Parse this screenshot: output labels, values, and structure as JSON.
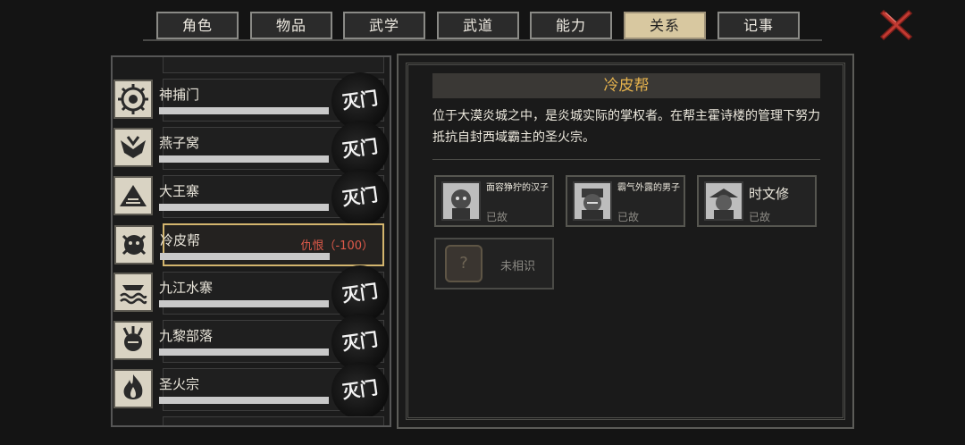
{
  "tabs": [
    {
      "label": "角色",
      "active": false
    },
    {
      "label": "物品",
      "active": false
    },
    {
      "label": "武学",
      "active": false
    },
    {
      "label": "武道",
      "active": false
    },
    {
      "label": "能力",
      "active": false
    },
    {
      "label": "关系",
      "active": true
    },
    {
      "label": "记事",
      "active": false
    }
  ],
  "close_icon": "close-x-icon",
  "factions": [
    {
      "name": "神捕门",
      "status": "灭门",
      "icon": "sun-emblem-icon"
    },
    {
      "name": "燕子窝",
      "status": "灭门",
      "icon": "swallow-emblem-icon"
    },
    {
      "name": "大王寨",
      "status": "灭门",
      "icon": "mountain-emblem-icon"
    },
    {
      "name": "冷皮帮",
      "hate": "仇恨（-100）",
      "selected": true,
      "icon": "beast-emblem-icon"
    },
    {
      "name": "九江水寨",
      "status": "灭门",
      "icon": "river-emblem-icon"
    },
    {
      "name": "九黎部落",
      "status": "灭门",
      "icon": "tribe-emblem-icon"
    },
    {
      "name": "圣火宗",
      "status": "灭门",
      "icon": "flame-emblem-icon"
    }
  ],
  "detail": {
    "title": "冷皮帮",
    "description": "位于大漠炎城之中，是炎城实际的掌权者。在帮主霍诗楼的管理下努力抵抗自封西域霸主的圣火宗。",
    "members": [
      {
        "name": "面容狰狞的汉子",
        "state": "已故",
        "big": false
      },
      {
        "name": "霸气外露的男子",
        "state": "已故",
        "big": false
      },
      {
        "name": "时文修",
        "state": "已故",
        "big": true
      }
    ],
    "unknown": {
      "symbol": "?",
      "label": "未相识"
    }
  },
  "colors": {
    "accent_gold": "#d3b56e",
    "title_orange": "#e6b34d",
    "hate_red": "#e05a4a"
  }
}
